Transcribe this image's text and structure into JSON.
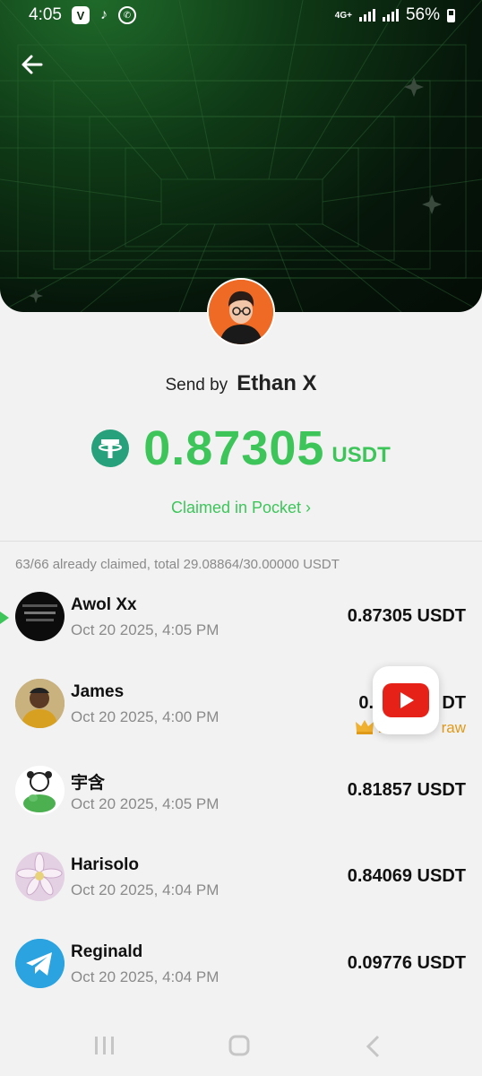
{
  "status_bar": {
    "time": "4:05",
    "network": "4G+",
    "battery": "56%"
  },
  "sender": {
    "label": "Send by",
    "name": "Ethan X"
  },
  "amount": {
    "value": "0.87305",
    "unit": "USDT"
  },
  "claimed_link": "Claimed in Pocket ›",
  "summary": "63/66 already claimed, total 29.08864/30.00000 USDT",
  "claims": [
    {
      "name": "Awol Xx",
      "time": "Oct 20 2025, 4:05 PM",
      "amount": "0.87305 USDT"
    },
    {
      "name": "James",
      "time": "Oct 20 2025, 4:00 PM",
      "amount": "0.93",
      "amount_tail": "DT",
      "badge": "Lu",
      "badge_tail": "raw"
    },
    {
      "name": "宇含",
      "time": "Oct 20 2025, 4:05 PM",
      "amount": "0.81857 USDT"
    },
    {
      "name": "Harisolo",
      "time": "Oct 20 2025, 4:04 PM",
      "amount": "0.84069 USDT"
    },
    {
      "name": "Reginald",
      "time": "Oct 20 2025, 4:04 PM",
      "amount": "0.09776 USDT"
    }
  ],
  "colors": {
    "accent_green": "#3dc55a",
    "tether": "#26a17b",
    "lucky_gold": "#e09a1a",
    "youtube_red": "#e62117"
  },
  "icons": [
    "back-arrow-icon",
    "tether-icon",
    "youtube-icon",
    "crown-icon",
    "telegram-icon"
  ]
}
